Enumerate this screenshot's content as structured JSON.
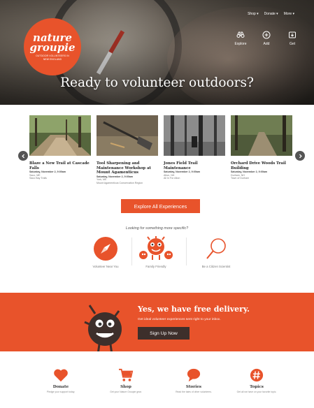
{
  "colors": {
    "accent": "#e8532b",
    "dark": "#3d2f2b"
  },
  "logo": {
    "line1": "nature",
    "line2": "groupie",
    "tagline": "OUTDOOR VOLUNTEERS IN NEW ENGLAND"
  },
  "topnav": [
    "Shop ▾",
    "Donate ▾",
    "More ▾"
  ],
  "icon_nav": [
    {
      "label": "Explore",
      "icon": "binoculars-icon"
    },
    {
      "label": "Add",
      "icon": "plus-circle-icon"
    },
    {
      "label": "Get",
      "icon": "download-icon"
    }
  ],
  "hero": {
    "title": "Ready to volunteer outdoors?"
  },
  "cards": [
    {
      "title": "Blaze a New Trail at Cascade Falls",
      "date": "Saturday, November 2, 9:00am",
      "place": "Saco, ME",
      "org": "Saco Bay Trails"
    },
    {
      "title": "Tool Sharpening and Maintenance Workshop at Mount Agamenticus",
      "date": "Saturday, November 2, 9:00am",
      "place": "York, ME",
      "org": "Mount Agamenticus Conservation Region"
    },
    {
      "title": "Jones Field Trail Maintenance",
      "date": "Saturday, November 2, 9:00am",
      "place": "Alton, NH",
      "org": "All In For Alton"
    },
    {
      "title": "Orchard Drive Woods Trail Building",
      "date": "Saturday, November 2, 9:00am",
      "place": "Durham, NH",
      "org": "Town of Durham"
    }
  ],
  "explore_button": "Explore All Experiences",
  "specific_text": "Looking for something more specific?",
  "categories": [
    {
      "label": "Volunteer Near You",
      "icon": "compass-icon"
    },
    {
      "label": "Family Friendly",
      "icon": "monster-family-icon"
    },
    {
      "label": "Be a Citizen Scientist",
      "icon": "magnifier-icon"
    }
  ],
  "banner": {
    "title": "Yes, we have free delivery.",
    "subtitle": "Get ideal volunteer experiences sent right to your inbox.",
    "button": "Sign Up Now"
  },
  "footer": [
    {
      "title": "Donate",
      "sub": "Pledge your support today.",
      "icon": "heart-icon"
    },
    {
      "title": "Shop",
      "sub": "Get your Nature Groupie gear.",
      "icon": "cart-icon"
    },
    {
      "title": "Stories",
      "sub": "Read the tales of other volunteers.",
      "icon": "speech-bubble-icon"
    },
    {
      "title": "Topics",
      "sub": "Get all we have on your favorite topic.",
      "icon": "hashtag-icon"
    }
  ]
}
